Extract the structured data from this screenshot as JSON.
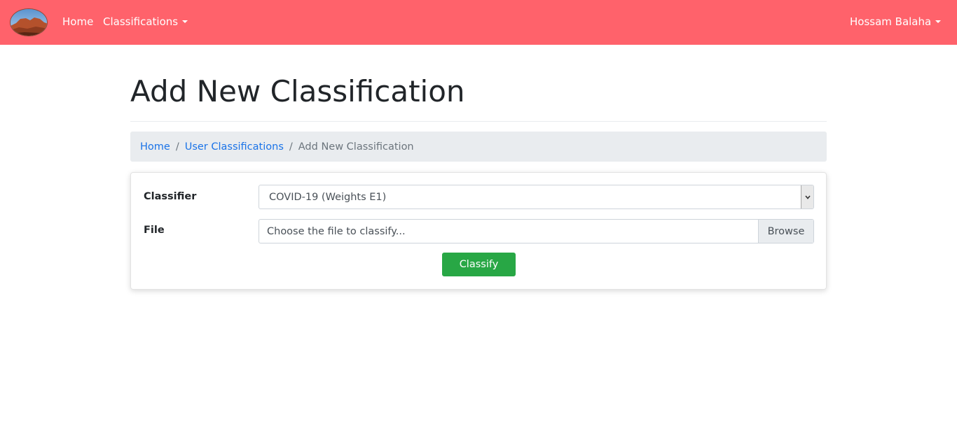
{
  "navbar": {
    "background": "#ff626b",
    "logo_icon": "landscape-avatar-icon",
    "home_label": "Home",
    "classifications_label": "Classifications",
    "user_label": "Hossam Balaha"
  },
  "page": {
    "title": "Add New Classification"
  },
  "breadcrumb": {
    "items": [
      {
        "label": "Home"
      },
      {
        "label": "User Classifications"
      },
      {
        "label": "Add New Classification"
      }
    ],
    "separator": "/"
  },
  "form": {
    "classifier_label": "Classifier",
    "classifier_value": "COVID-19 (Weights E1)",
    "file_label": "File",
    "file_placeholder": "Choose the file to classify...",
    "browse_label": "Browse",
    "submit_label": "Classify",
    "submit_color": "#28a745"
  }
}
